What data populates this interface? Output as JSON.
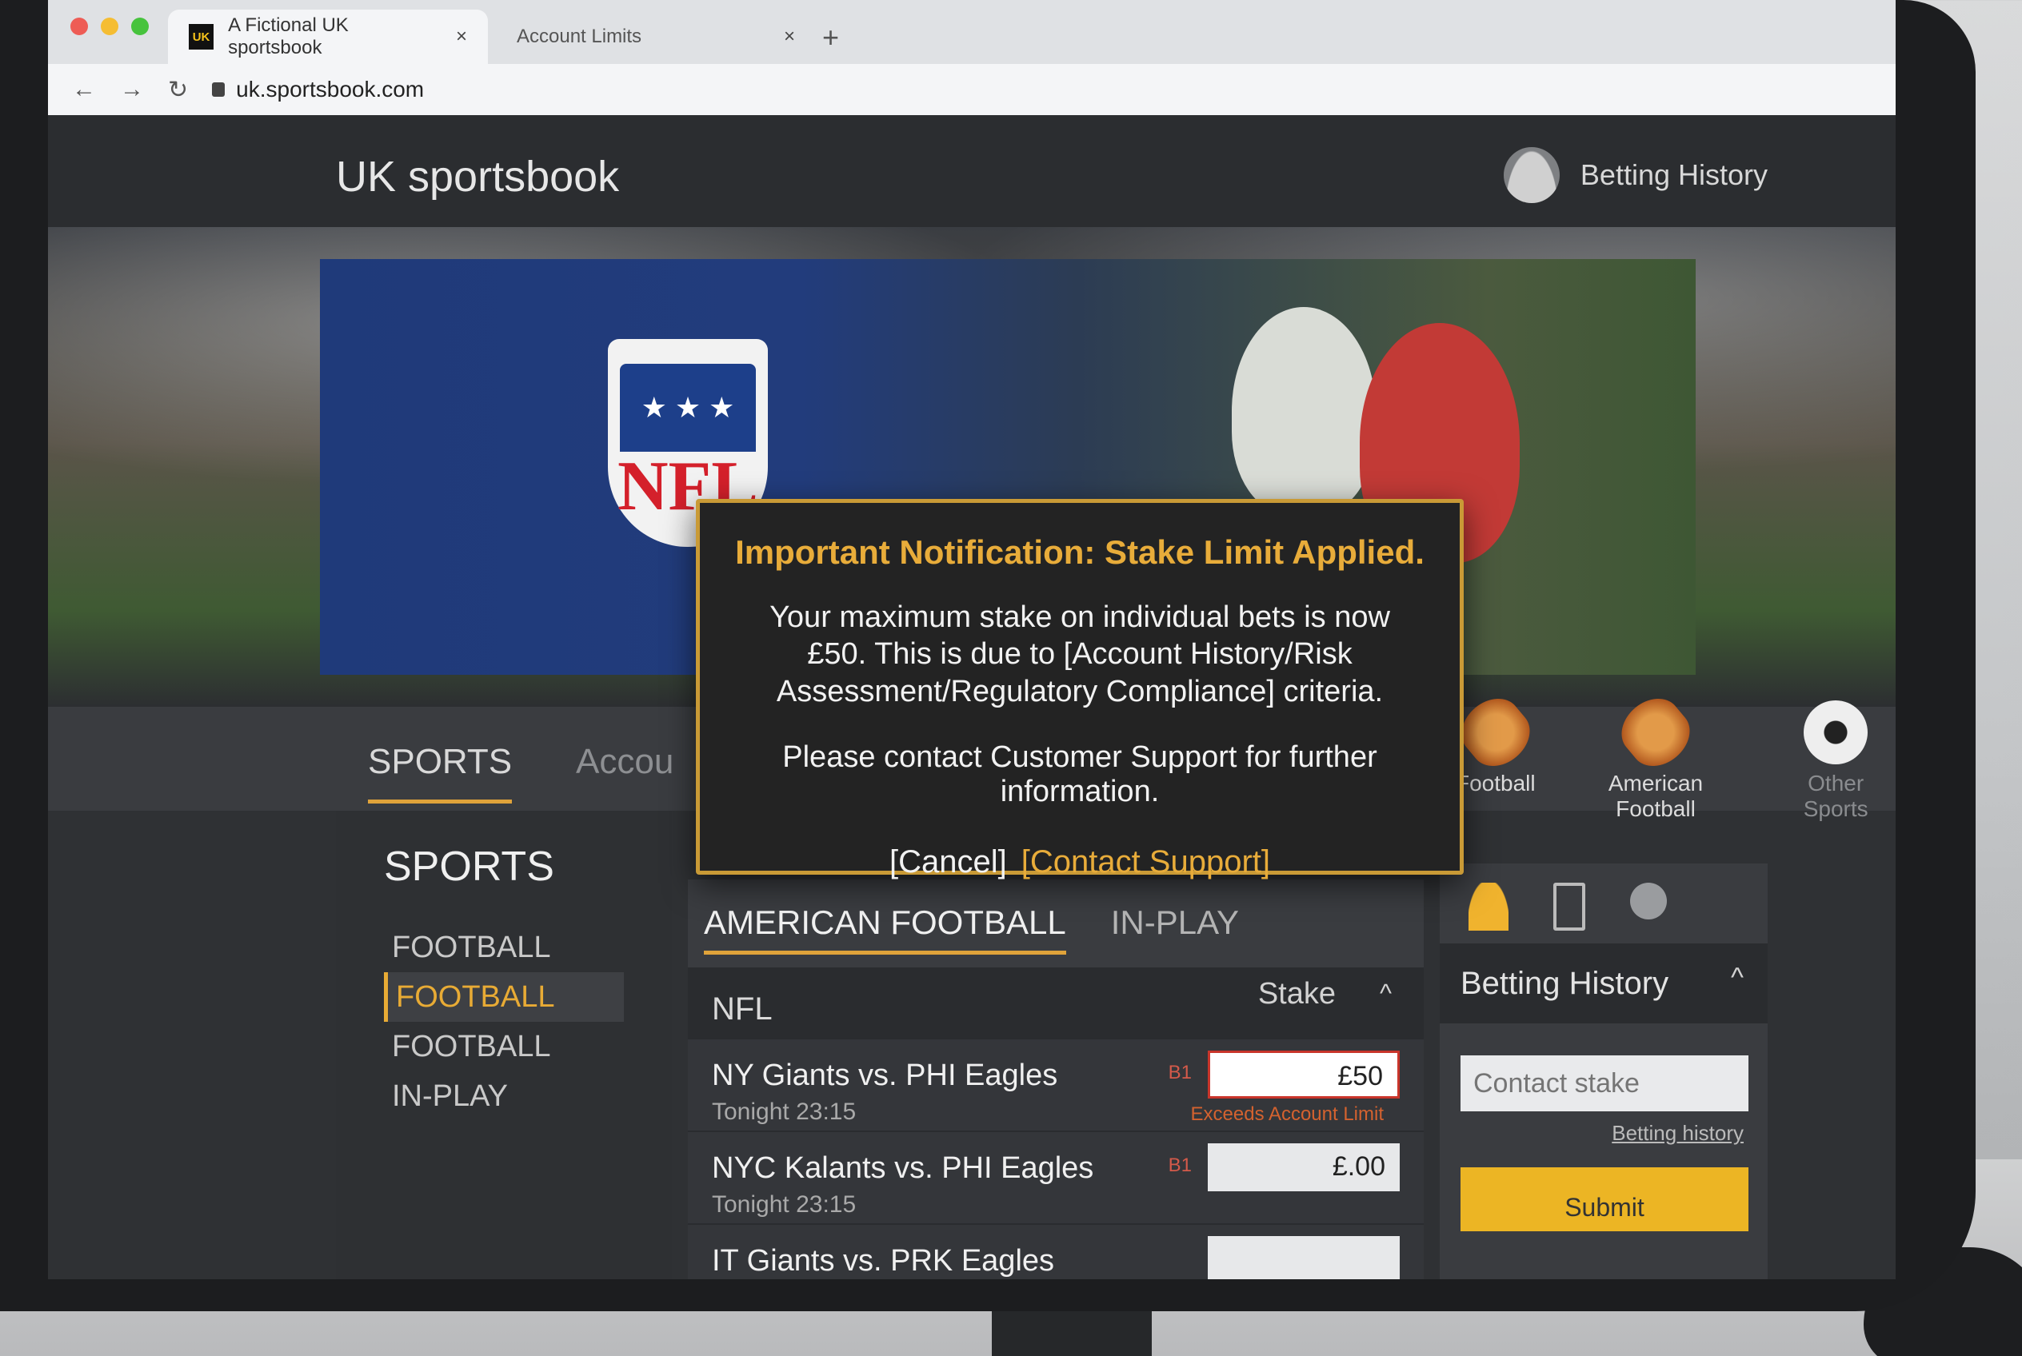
{
  "browser": {
    "tabs": [
      {
        "label": "A Fictional UK sportsbook",
        "favicon": "UK",
        "active": true
      },
      {
        "label": "Account Limits",
        "active": false
      }
    ],
    "new_tab": "+",
    "close": "×",
    "url": "uk.sportsbook.com",
    "nav": {
      "back": "←",
      "forward": "→",
      "reload": "↻"
    }
  },
  "header": {
    "logo": "UK sportsbook",
    "account_link": "Betting History"
  },
  "hero": {
    "shield_word": "NFL",
    "shield_stars": "★ ★ ★"
  },
  "category_bar": {
    "tabs": [
      {
        "label": "SPORTS"
      },
      {
        "label": "Accou"
      }
    ],
    "sport_icons": [
      {
        "label": "Football",
        "icon": "american-football-icon"
      },
      {
        "label": "American Football",
        "icon": "american-football-icon"
      },
      {
        "label": "Other Sports",
        "icon": "soccer-ball-icon"
      }
    ]
  },
  "left_nav": {
    "heading": "SPORTS",
    "items": [
      "FOOTBALL",
      "FOOTBALL",
      "FOOTBALL",
      "IN-PLAY"
    ],
    "selected_index": 1
  },
  "events": {
    "tabs": [
      "AMERICAN FOOTBALL",
      "IN-PLAY"
    ],
    "league": "NFL",
    "stake_header": "Stake",
    "caret": "^",
    "rows": [
      {
        "match": "NY Giants vs. PHI Eagles",
        "time": "Tonight 23:15",
        "tag": "B1",
        "stake": "£50",
        "error": "Exceeds Account Limit"
      },
      {
        "match": "NYC Kalants vs. PHI Eagles",
        "time": "Tonight 23:15",
        "tag": "B1",
        "stake": "£.00",
        "error": ""
      },
      {
        "match": "IT Giants vs. PRK Eagles",
        "time": "",
        "tag": "",
        "stake": "",
        "error": ""
      }
    ]
  },
  "right_panel": {
    "title": "Betting History",
    "caret": "^",
    "input_placeholder": "Contact stake",
    "link": "Betting history",
    "submit": "Submit"
  },
  "modal": {
    "title": "Important Notification: Stake Limit Applied.",
    "body": "Your maximum stake on individual bets is now £50. This is due to [Account History/Risk Assessment/Regulatory Compliance] criteria.",
    "body2": "Please contact Customer Support for further information.",
    "cancel": "[Cancel]",
    "contact": "[Contact Support]"
  },
  "colors": {
    "accent": "#e8ac3a",
    "error": "#c9352b",
    "submit": "#ecb524"
  }
}
